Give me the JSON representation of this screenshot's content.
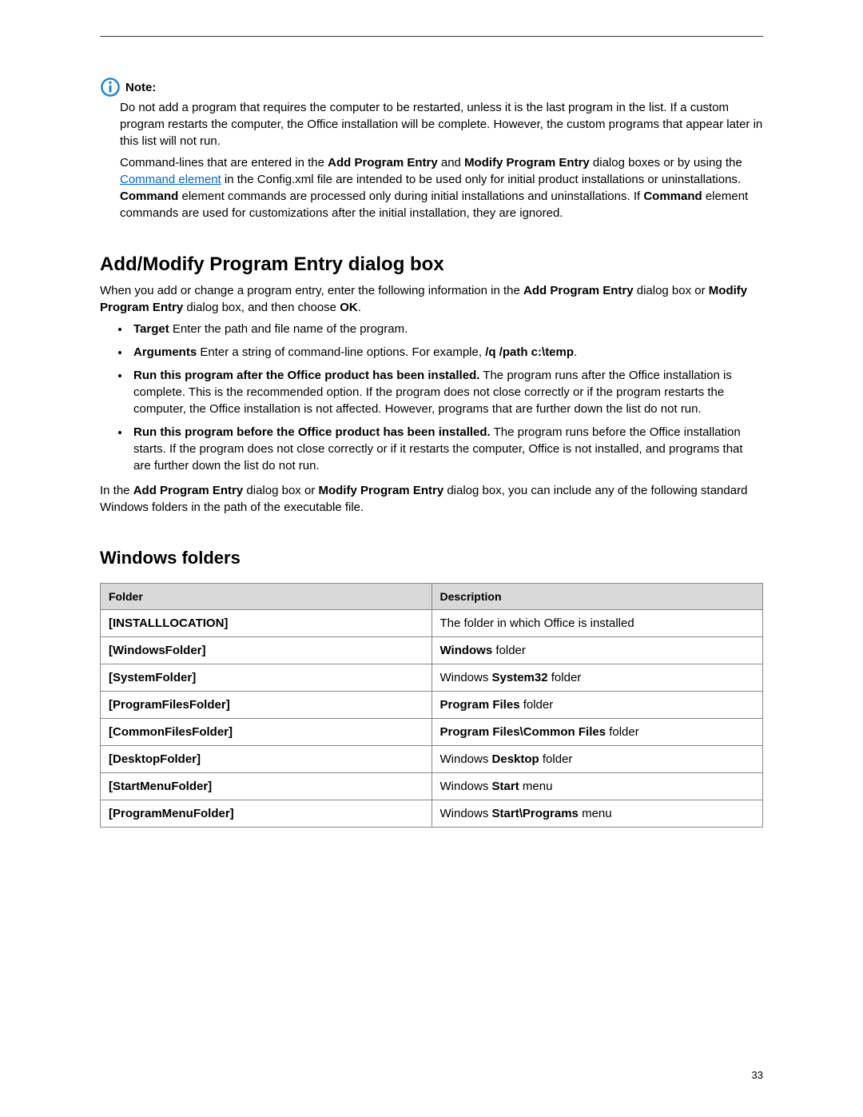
{
  "note": {
    "label": "Note:",
    "p1_parts": [
      "Do not add a program that requires the computer to be restarted, unless it is the last program in the list. If a custom program restarts the computer, the Office installation will be complete. However, the custom programs that appear later in this list will not run."
    ],
    "p2_pre": "Command-lines that are entered in the ",
    "p2_b1": "Add Program Entry",
    "p2_mid1": " and ",
    "p2_b2": "Modify Program Entry",
    "p2_mid2": " dialog boxes or by using the ",
    "p2_link": "Command element",
    "p2_mid3": " in the Config.xml file are intended to be used only for initial product installations or uninstallations. ",
    "p2_b3": "Command",
    "p2_mid4": " element commands are processed only during initial installations and uninstallations. If ",
    "p2_b4": "Command",
    "p2_post": " element commands are used for customizations after the initial installation, they are ignored."
  },
  "section1": {
    "title": "Add/Modify Program Entry dialog box",
    "intro_pre": "When you add or change a program entry, enter the following information in the ",
    "intro_b1": "Add Program Entry",
    "intro_mid": " dialog box or ",
    "intro_b2": "Modify Program Entry",
    "intro_mid2": " dialog box, and then choose ",
    "intro_b3": "OK",
    "intro_post": ".",
    "bullets": {
      "b1_label": "Target",
      "b1_text": "   Enter the path and file name of the program.",
      "b2_label": "Arguments",
      "b2_text_pre": "   Enter a string of command-line options. For example, ",
      "b2_code": "/q /path c:\\temp",
      "b2_post": ".",
      "b3_label": "Run this program after the Office product has been installed.",
      "b3_text": "   The program runs after the Office installation is complete. This is the recommended option. If the program does not close correctly or if the program restarts the computer, the Office installation is not affected. However, programs that are further down the list do not run.",
      "b4_label": "Run this program before the Office product has been installed.",
      "b4_text": "   The program runs before the Office installation starts. If the program does not close correctly or if it restarts the computer, Office is not installed, and programs that are further down the list do not run."
    },
    "outro_pre": "In the ",
    "outro_b1": "Add Program Entry",
    "outro_mid": " dialog box or ",
    "outro_b2": "Modify Program Entry",
    "outro_post": " dialog box, you can include any of the following standard Windows folders in the path of the executable file."
  },
  "windows_folders": {
    "title": "Windows folders",
    "headers": {
      "col1": "Folder",
      "col2": "Description"
    },
    "rows": [
      {
        "folder": "[INSTALLLOCATION]",
        "desc_pre": "The folder in which Office is installed",
        "desc_bold": "",
        "desc_post": ""
      },
      {
        "folder": "[WindowsFolder]",
        "desc_pre": "",
        "desc_bold": "Windows",
        "desc_post": " folder"
      },
      {
        "folder": "[SystemFolder]",
        "desc_pre": "Windows ",
        "desc_bold": "System32",
        "desc_post": " folder"
      },
      {
        "folder": "[ProgramFilesFolder]",
        "desc_pre": "",
        "desc_bold": "Program Files",
        "desc_post": " folder"
      },
      {
        "folder": "[CommonFilesFolder]",
        "desc_pre": "",
        "desc_bold": "Program Files\\Common Files",
        "desc_post": " folder"
      },
      {
        "folder": "[DesktopFolder]",
        "desc_pre": "Windows ",
        "desc_bold": "Desktop",
        "desc_post": " folder"
      },
      {
        "folder": "[StartMenuFolder]",
        "desc_pre": "Windows ",
        "desc_bold": "Start",
        "desc_post": " menu"
      },
      {
        "folder": "[ProgramMenuFolder]",
        "desc_pre": "Windows ",
        "desc_bold": "Start\\Programs",
        "desc_post": " menu"
      }
    ]
  },
  "page_number": "33"
}
